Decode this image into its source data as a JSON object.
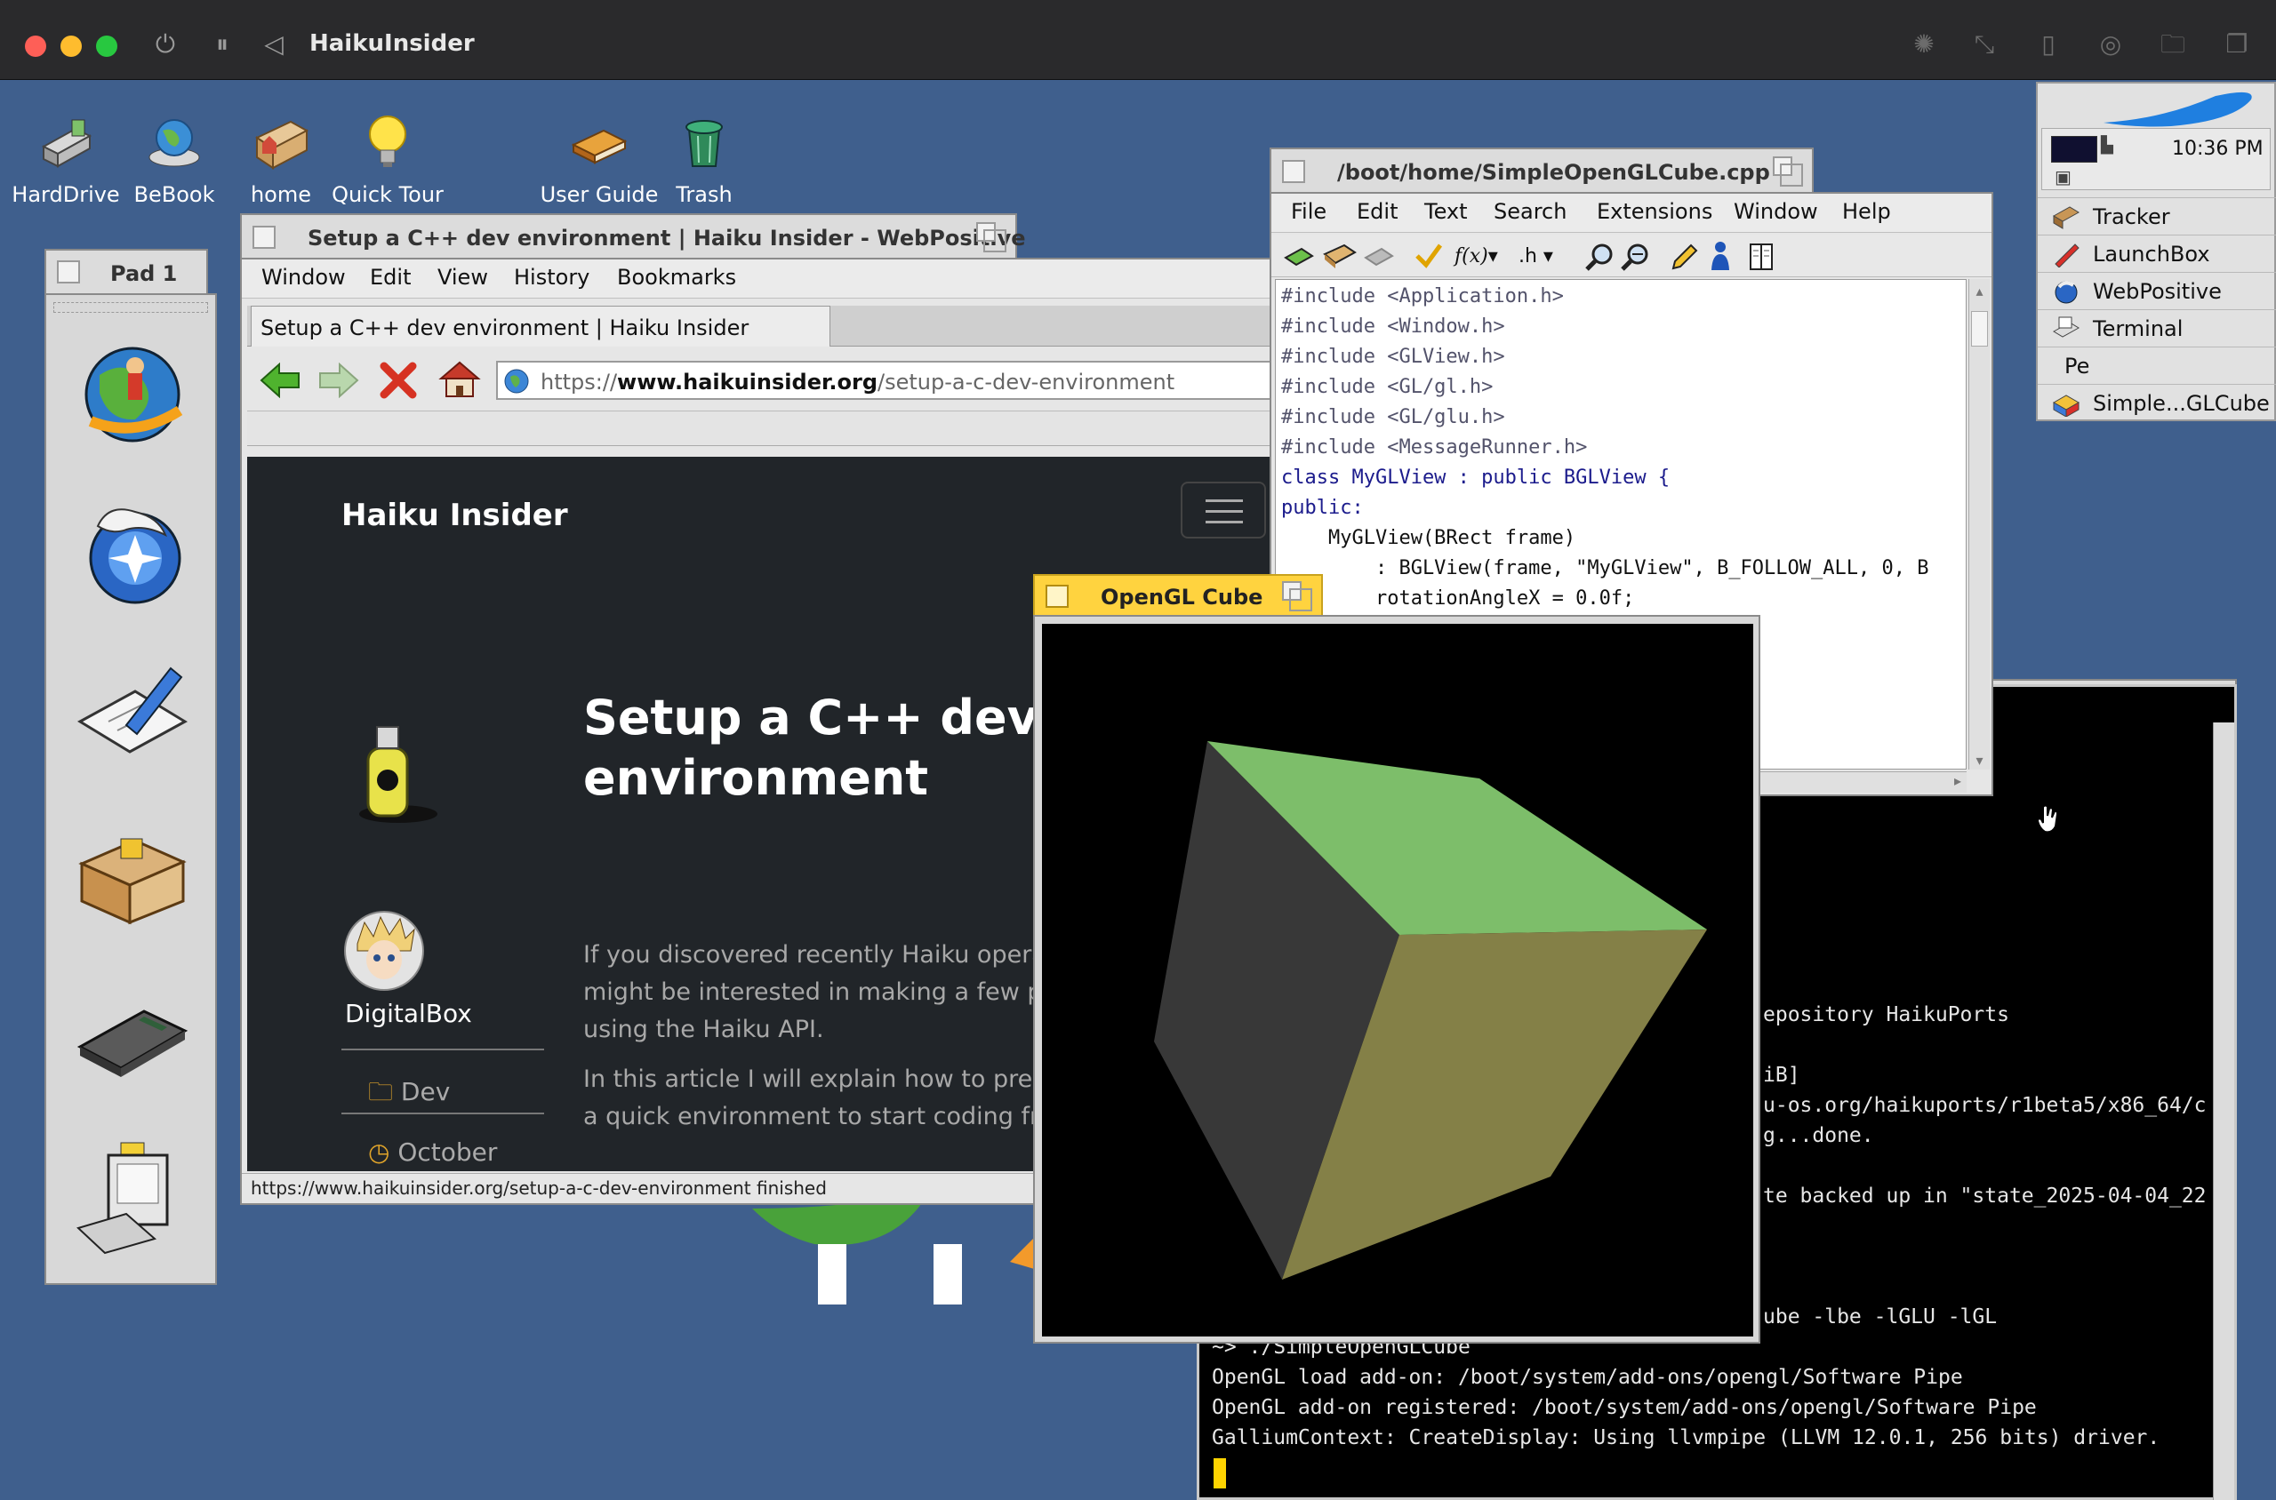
{
  "host": {
    "title": "HaikuInsider",
    "controls": [
      "power-icon",
      "pause-icon",
      "back-icon"
    ],
    "right_icons": [
      "brightness-icon",
      "resize-icon",
      "usb-icon",
      "camera-icon",
      "folder-icon",
      "windows-icon"
    ]
  },
  "desktop": {
    "icons": [
      {
        "label": "HardDrive",
        "icon": "harddrive-icon"
      },
      {
        "label": "BeBook",
        "icon": "globe-book-icon"
      },
      {
        "label": "home",
        "icon": "home-folder-icon"
      },
      {
        "label": "Quick Tour",
        "icon": "lightbulb-icon"
      },
      {
        "label": "User Guide",
        "icon": "book-icon"
      },
      {
        "label": "Trash",
        "icon": "trash-icon"
      }
    ]
  },
  "pad": {
    "title": "Pad 1",
    "items": [
      "surfer-globe-icon",
      "webpositive-icon",
      "styledit-icon",
      "installer-box-icon",
      "calculator-icon",
      "computer-icon"
    ]
  },
  "browser": {
    "title": "Setup a C++ dev environment | Haiku Insider - WebPositive",
    "menu": [
      "Window",
      "Edit",
      "View",
      "History",
      "Bookmarks"
    ],
    "tab_label": "Setup a C++ dev environment | Haiku Insider",
    "url_prefix": "https://",
    "url_domain": "www.haikuinsider.org",
    "url_path": "/setup-a-c-dev-environment",
    "status": "https://www.haikuinsider.org/setup-a-c-dev-environment finished",
    "site_name": "Haiku Insider",
    "article_title_1": "Setup a C++ dev",
    "article_title_2": "environment",
    "author": "DigitalBox",
    "category": "Dev",
    "date": "October",
    "para1_l1": "If you discovered recently Haiku opera",
    "para1_l2": "might be interested in making a few p",
    "para1_l3": "using the Haiku API.",
    "para2_l1": "In this article I will explain how to pre",
    "para2_l2": "a quick environment to start coding fr"
  },
  "editor": {
    "title": "/boot/home/SimpleOpenGLCube.cpp",
    "menu": [
      "File",
      "Edit",
      "Text",
      "Search",
      "Extensions",
      "Window",
      "Help"
    ],
    "toolbar_fx": "f(x)",
    "toolbar_h": ".h",
    "lines": [
      "#include <Application.h>",
      "#include <Window.h>",
      "#include <GLView.h>",
      "#include <GL/gl.h>",
      "#include <GL/glu.h>",
      "#include <MessageRunner.h>",
      "class MyGLView : public BGLView {",
      "public:",
      "    MyGLView(BRect frame)",
      "        : BGLView(frame, \"MyGLView\", B_FOLLOW_ALL, 0, B",
      "        rotationAngleX = 0.0f;"
    ]
  },
  "cube": {
    "title": "OpenGL Cube",
    "colors": {
      "top": "#7dbe6a",
      "front": "#848047",
      "left": "#383838"
    }
  },
  "terminal": {
    "lines_right": [
      "epository HaikuPorts",
      "iB]",
      "u-os.org/haikuports/r1beta5/x86_64/c",
      "g...done.",
      "te backed up in \"state_2025-04-04_22",
      "ube -lbe -lGLU -lGL"
    ],
    "line_run": "~> ./SimpleOpenGLCube",
    "line_1": "OpenGL load add-on: /boot/system/add-ons/opengl/Software Pipe",
    "line_2": "OpenGL add-on registered: /boot/system/add-ons/opengl/Software Pipe",
    "line_3": "GalliumContext: CreateDisplay: Using llvmpipe (LLVM 12.0.1, 256 bits) driver."
  },
  "deskbar": {
    "clock": "10:36 PM",
    "items": [
      {
        "label": "Tracker",
        "icon": "tracker-icon"
      },
      {
        "label": "LaunchBox",
        "icon": "launchbox-icon"
      },
      {
        "label": "WebPositive",
        "icon": "webpositive-icon"
      },
      {
        "label": "Terminal",
        "icon": "terminal-icon"
      },
      {
        "label": "Pe",
        "icon": ""
      },
      {
        "label": "Simple...GLCube",
        "icon": "app-icon"
      }
    ]
  }
}
